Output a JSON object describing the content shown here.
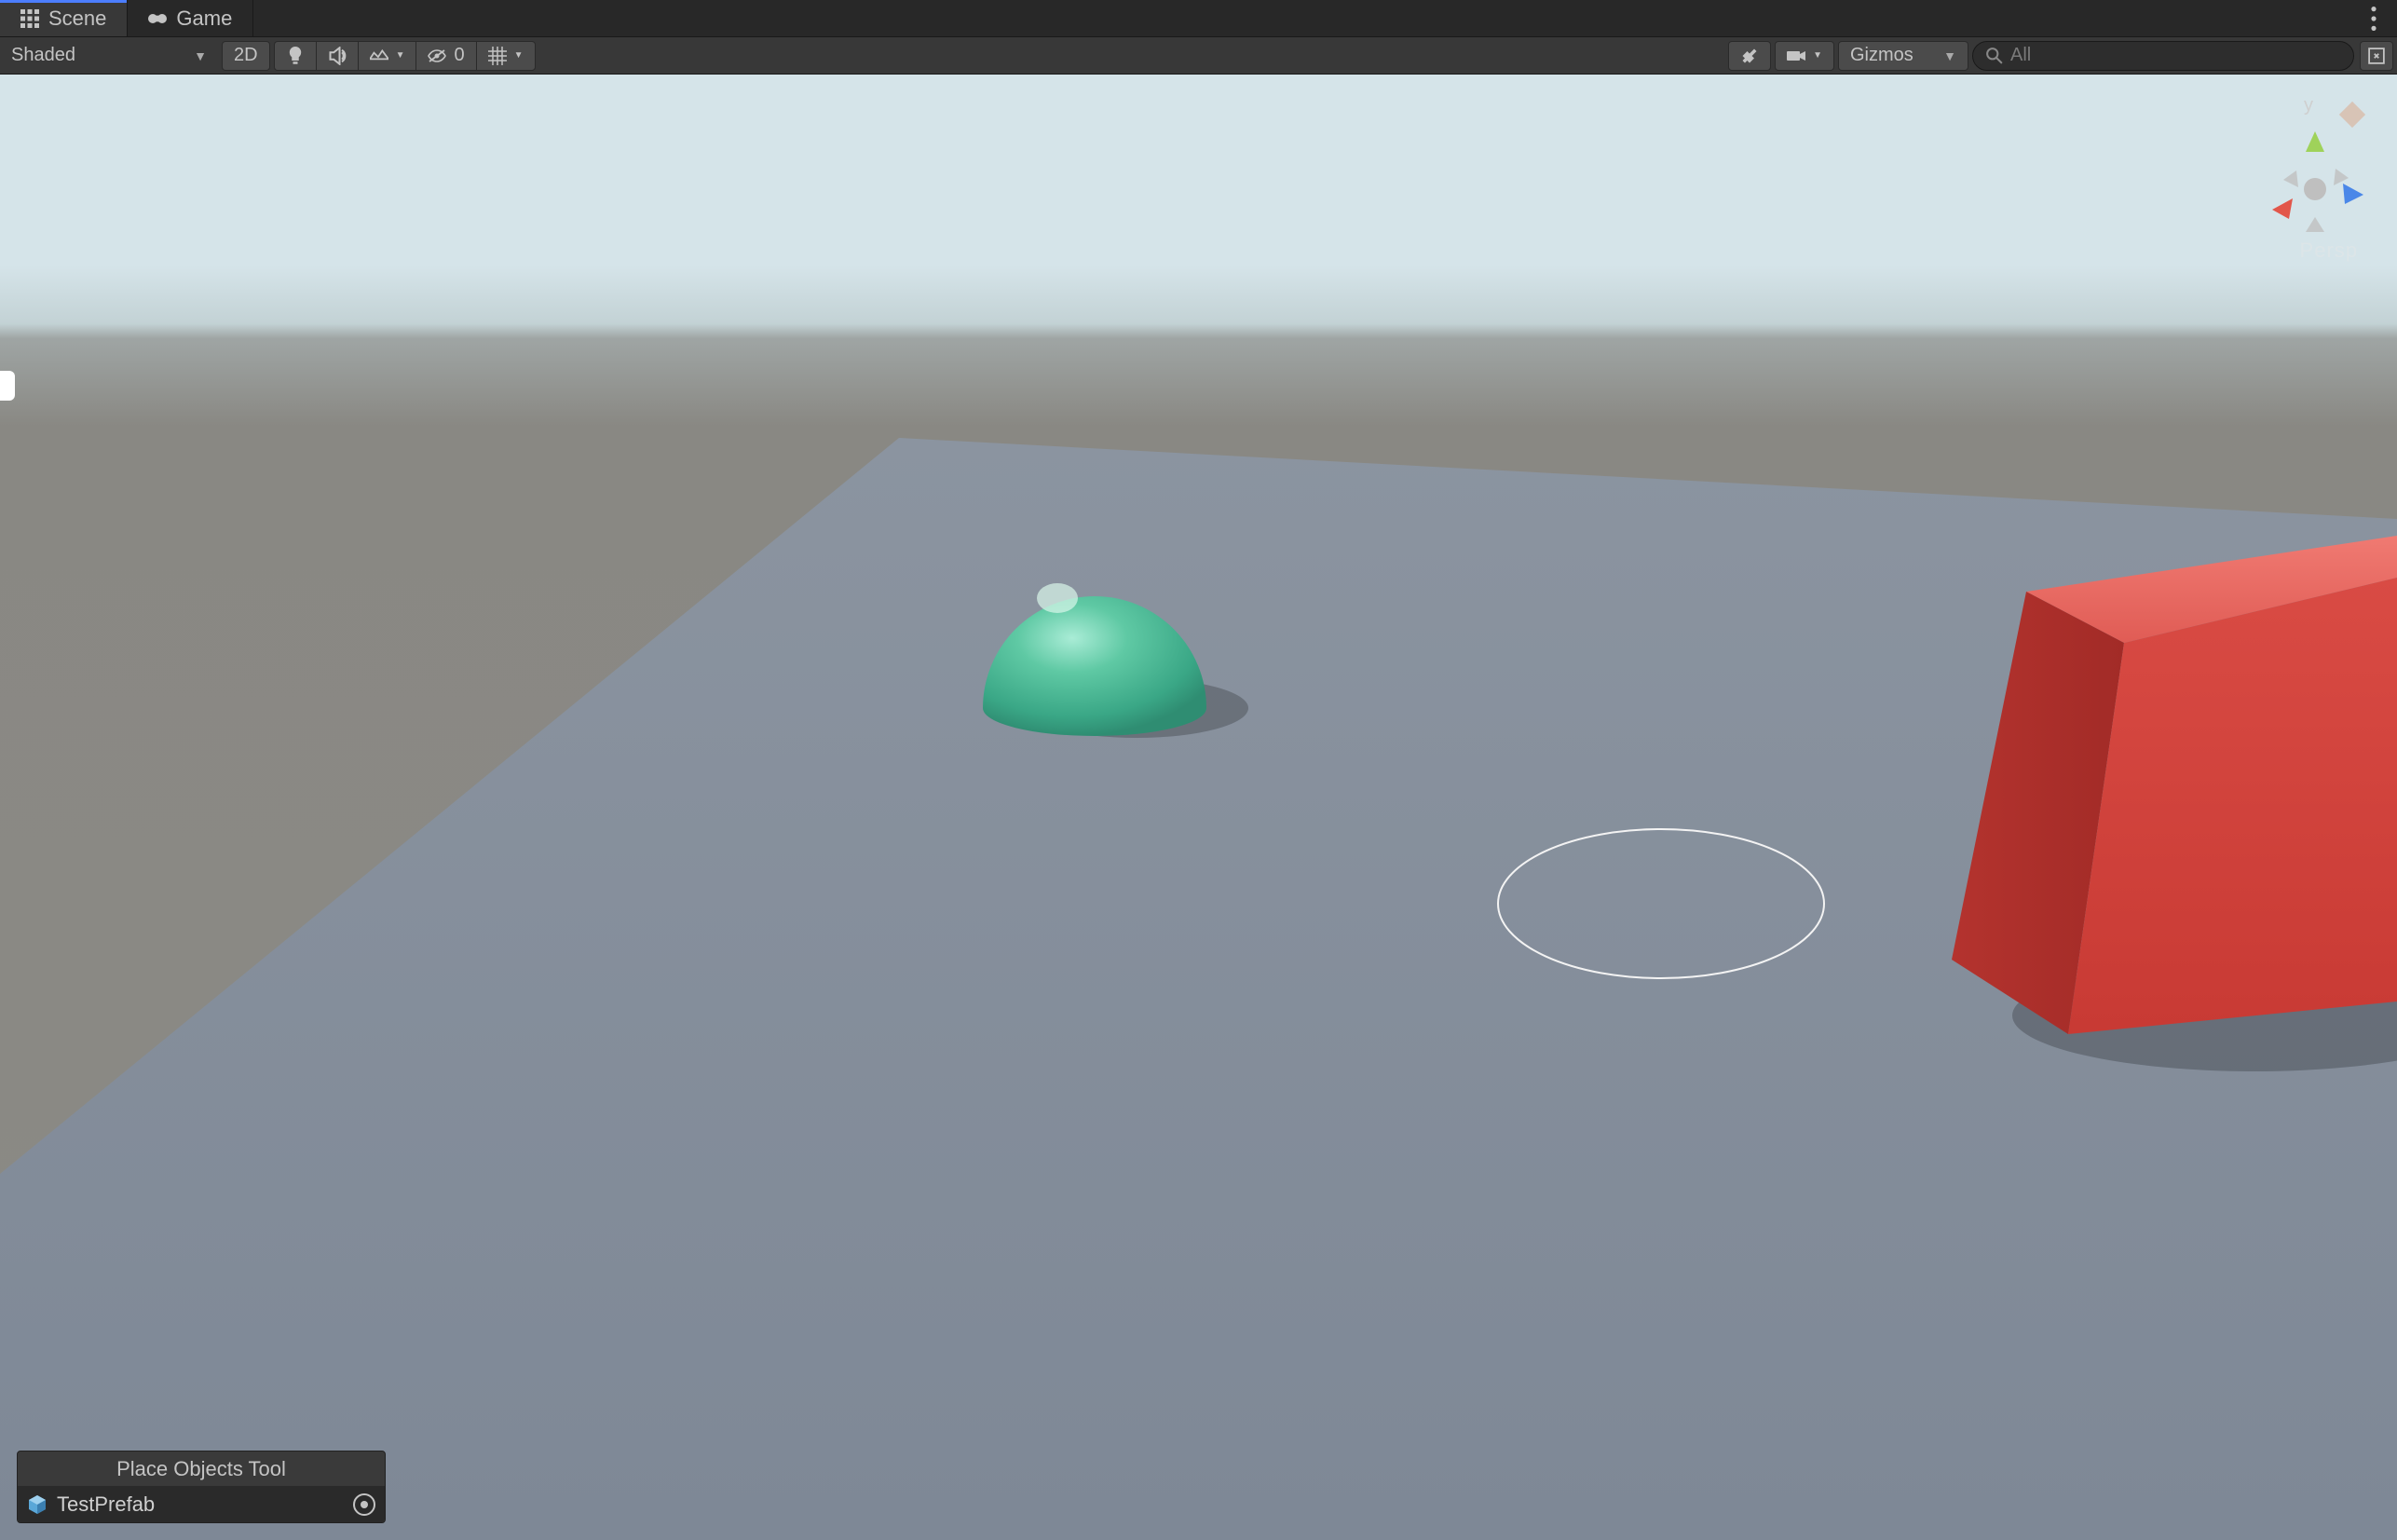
{
  "tabs": {
    "scene": "Scene",
    "game": "Game"
  },
  "toolbar": {
    "shading_mode": "Shaded",
    "btn_2d": "2D",
    "hidden_count": "0",
    "gizmos_label": "Gizmos",
    "search_placeholder": "All"
  },
  "axis_gizmo": {
    "y_label": "y",
    "projection": "Persp"
  },
  "place_tool": {
    "title": "Place Objects Tool",
    "prefab_name": "TestPrefab"
  }
}
